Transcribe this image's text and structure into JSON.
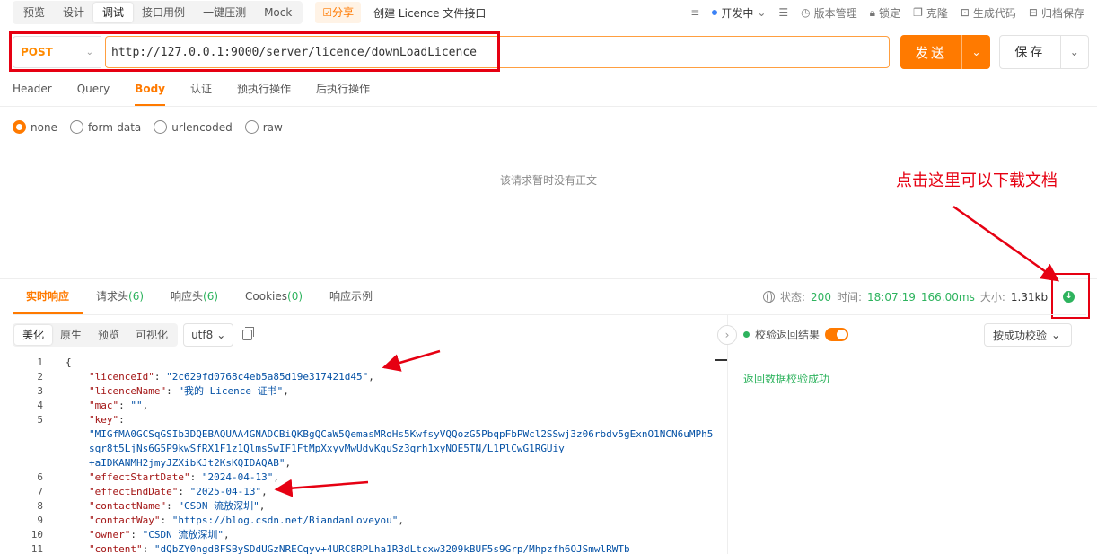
{
  "top_tabs": [
    "预览",
    "设计",
    "调试",
    "接口用例",
    "一键压测",
    "Mock"
  ],
  "active_top_tab": "调试",
  "share_label": "分享",
  "doc_title": "创建 Licence 文件接口",
  "top_right": {
    "environment": "开发中",
    "version": "版本管理",
    "lock": "锁定",
    "clone": "克隆",
    "gen_code": "生成代码",
    "archive": "归档保存"
  },
  "request": {
    "method": "POST",
    "url": "http://127.0.0.1:9000/server/licence/downLoadLicence",
    "send_label": "发送",
    "save_label": "保存"
  },
  "request_tabs": [
    "Header",
    "Query",
    "Body",
    "认证",
    "预执行操作",
    "后执行操作"
  ],
  "body_types": [
    "none",
    "form-data",
    "urlencoded",
    "raw"
  ],
  "empty_body_text": "该请求暂时没有正文",
  "annotation": "点击这里可以下载文档",
  "response_tabs": [
    {
      "label": "实时响应",
      "count": ""
    },
    {
      "label": "请求头",
      "count": "(6)"
    },
    {
      "label": "响应头",
      "count": "(6)"
    },
    {
      "label": "Cookies",
      "count": "(0)"
    },
    {
      "label": "响应示例",
      "count": ""
    }
  ],
  "status": {
    "status_label": "状态:",
    "status_code": "200",
    "time_label": "时间:",
    "time": "18:07:19",
    "duration": "166.00ms",
    "size_label": "大小:",
    "size": "1.31kb"
  },
  "viewer_modes": [
    "美化",
    "原生",
    "预览",
    "可视化"
  ],
  "encoding": "utf8",
  "verify": {
    "label": "校验返回结果",
    "mode": "按成功校验",
    "result": "返回数据校验成功"
  },
  "code_lines": [
    {
      "n": "1",
      "ind": 0,
      "k": "",
      "s": "",
      "p": "{"
    },
    {
      "n": "2",
      "ind": 1,
      "k": "\"licenceId\"",
      "s": "\"2c629fd0768c4eb5a85d19e317421d45\"",
      "p": ","
    },
    {
      "n": "3",
      "ind": 1,
      "k": "\"licenceName\"",
      "s": "\"我的 Licence 证书\"",
      "p": ","
    },
    {
      "n": "4",
      "ind": 1,
      "k": "\"mac\"",
      "s": "\"\"",
      "p": ","
    },
    {
      "n": "5",
      "ind": 1,
      "k": "\"key\"",
      "s": "",
      "p": ""
    },
    {
      "n": "",
      "ind": 1,
      "k": "",
      "s": "\"MIGfMA0GCSqGSIb3DQEBAQUAA4GNADCBiQKBgQCaW5QemasMRoHs5KwfsyVQQozG5PbqpFbPWcl2SSwj3z06rbdv5gExnO1NCN6uMPh5",
      "p": ""
    },
    {
      "n": "",
      "ind": 1,
      "k": "",
      "s": "sqr8t5LjNs6G5P9kwSfRX1F1z1QlmsSwIF1FtMpXxyvMwUdvKguSz3qrh1xyNOE5TN/L1PlCwG1RGUiy",
      "p": ""
    },
    {
      "n": "",
      "ind": 1,
      "k": "",
      "s": "+aIDKANMH2jmyJZXibKJt2KsKQIDAQAB\"",
      "p": ","
    },
    {
      "n": "6",
      "ind": 1,
      "k": "\"effectStartDate\"",
      "s": "\"2024-04-13\"",
      "p": ","
    },
    {
      "n": "7",
      "ind": 1,
      "k": "\"effectEndDate\"",
      "s": "\"2025-04-13\"",
      "p": ","
    },
    {
      "n": "8",
      "ind": 1,
      "k": "\"contactName\"",
      "s": "\"CSDN 流放深圳\"",
      "p": ","
    },
    {
      "n": "9",
      "ind": 1,
      "k": "\"contactWay\"",
      "s": "\"https://blog.csdn.net/BiandanLoveyou\"",
      "p": ","
    },
    {
      "n": "10",
      "ind": 1,
      "k": "\"owner\"",
      "s": "\"CSDN 流放深圳\"",
      "p": ","
    },
    {
      "n": "11",
      "ind": 1,
      "k": "\"content\"",
      "s": "\"dQbZY0ngd8FSBySDdUGzNRECqyv+4URC8RPLha1R3dLtcxw3209kBUF5s9Grp/Mhpzfh6OJSmwlRWTb",
      "p": ""
    }
  ],
  "colors": {
    "accent": "#ff7a00",
    "success": "#2eb35e",
    "annotation": "#e60012"
  }
}
